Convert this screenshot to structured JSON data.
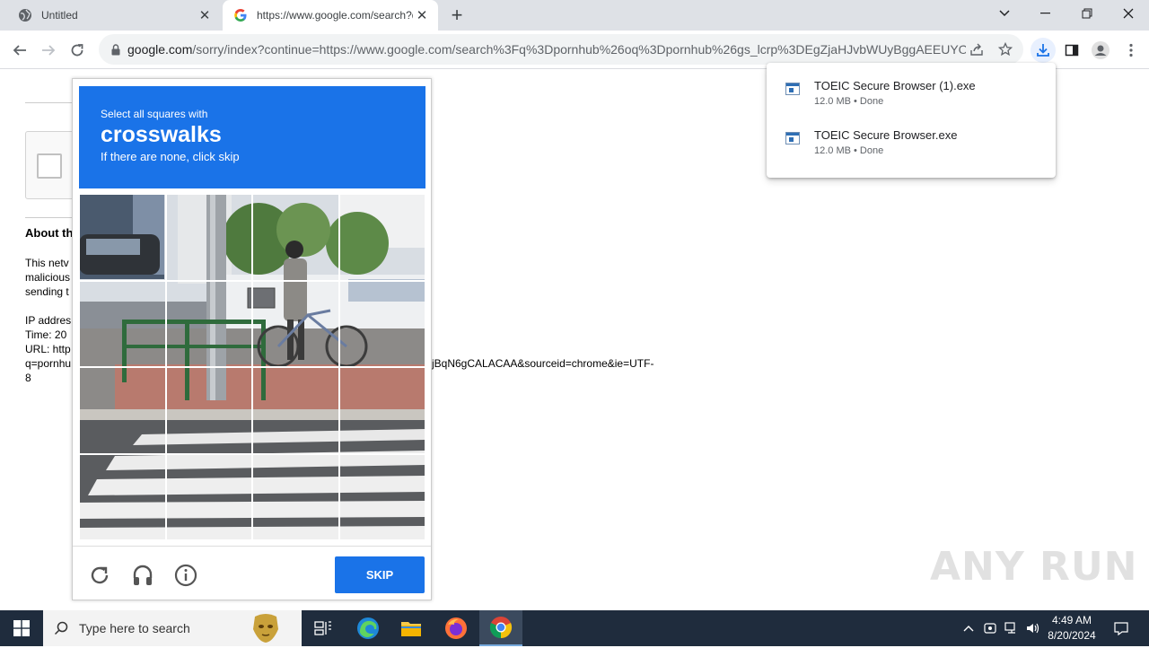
{
  "tabs": [
    {
      "title": "Untitled",
      "close": "✕"
    },
    {
      "title": "https://www.google.com/search?q",
      "close": "✕"
    }
  ],
  "newtab_label": "+",
  "address_bar": {
    "host": "google.com",
    "path": "/sorry/index?continue=https://www.google.com/search%3Fq%3Dpornhub%26oq%3Dpornhub%26gs_lcrp%3DEgZjaHJvbWUyBggAEEUYO..."
  },
  "background_page": {
    "heading": "About th",
    "lines": [
      "This netv",
      "malicious",
      "sending t"
    ],
    "info_lines": [
      "IP addres",
      "Time: 20",
      "URL: http",
      "q=pornhu",
      "8"
    ],
    "url_tail": "jBqN6gCALACAA&sourceid=chrome&ie=UTF-"
  },
  "captcha": {
    "instruction_small": "Select all squares with",
    "target": "crosswalks",
    "instruction_sub": "If there are none, click skip",
    "skip_label": "SKIP",
    "grid_rows": 4,
    "grid_cols": 4
  },
  "downloads": [
    {
      "name": "TOEIC Secure Browser (1).exe",
      "meta": "12.0 MB • Done"
    },
    {
      "name": "TOEIC Secure Browser.exe",
      "meta": "12.0 MB • Done"
    }
  ],
  "watermark": "ANY RUN",
  "taskbar": {
    "search_placeholder": "Type here to search",
    "time": "4:49 AM",
    "date": "8/20/2024"
  },
  "colors": {
    "accent_blue": "#1a73e8",
    "taskbar": "#1f2c3d",
    "tabstrip": "#dee1e6"
  }
}
